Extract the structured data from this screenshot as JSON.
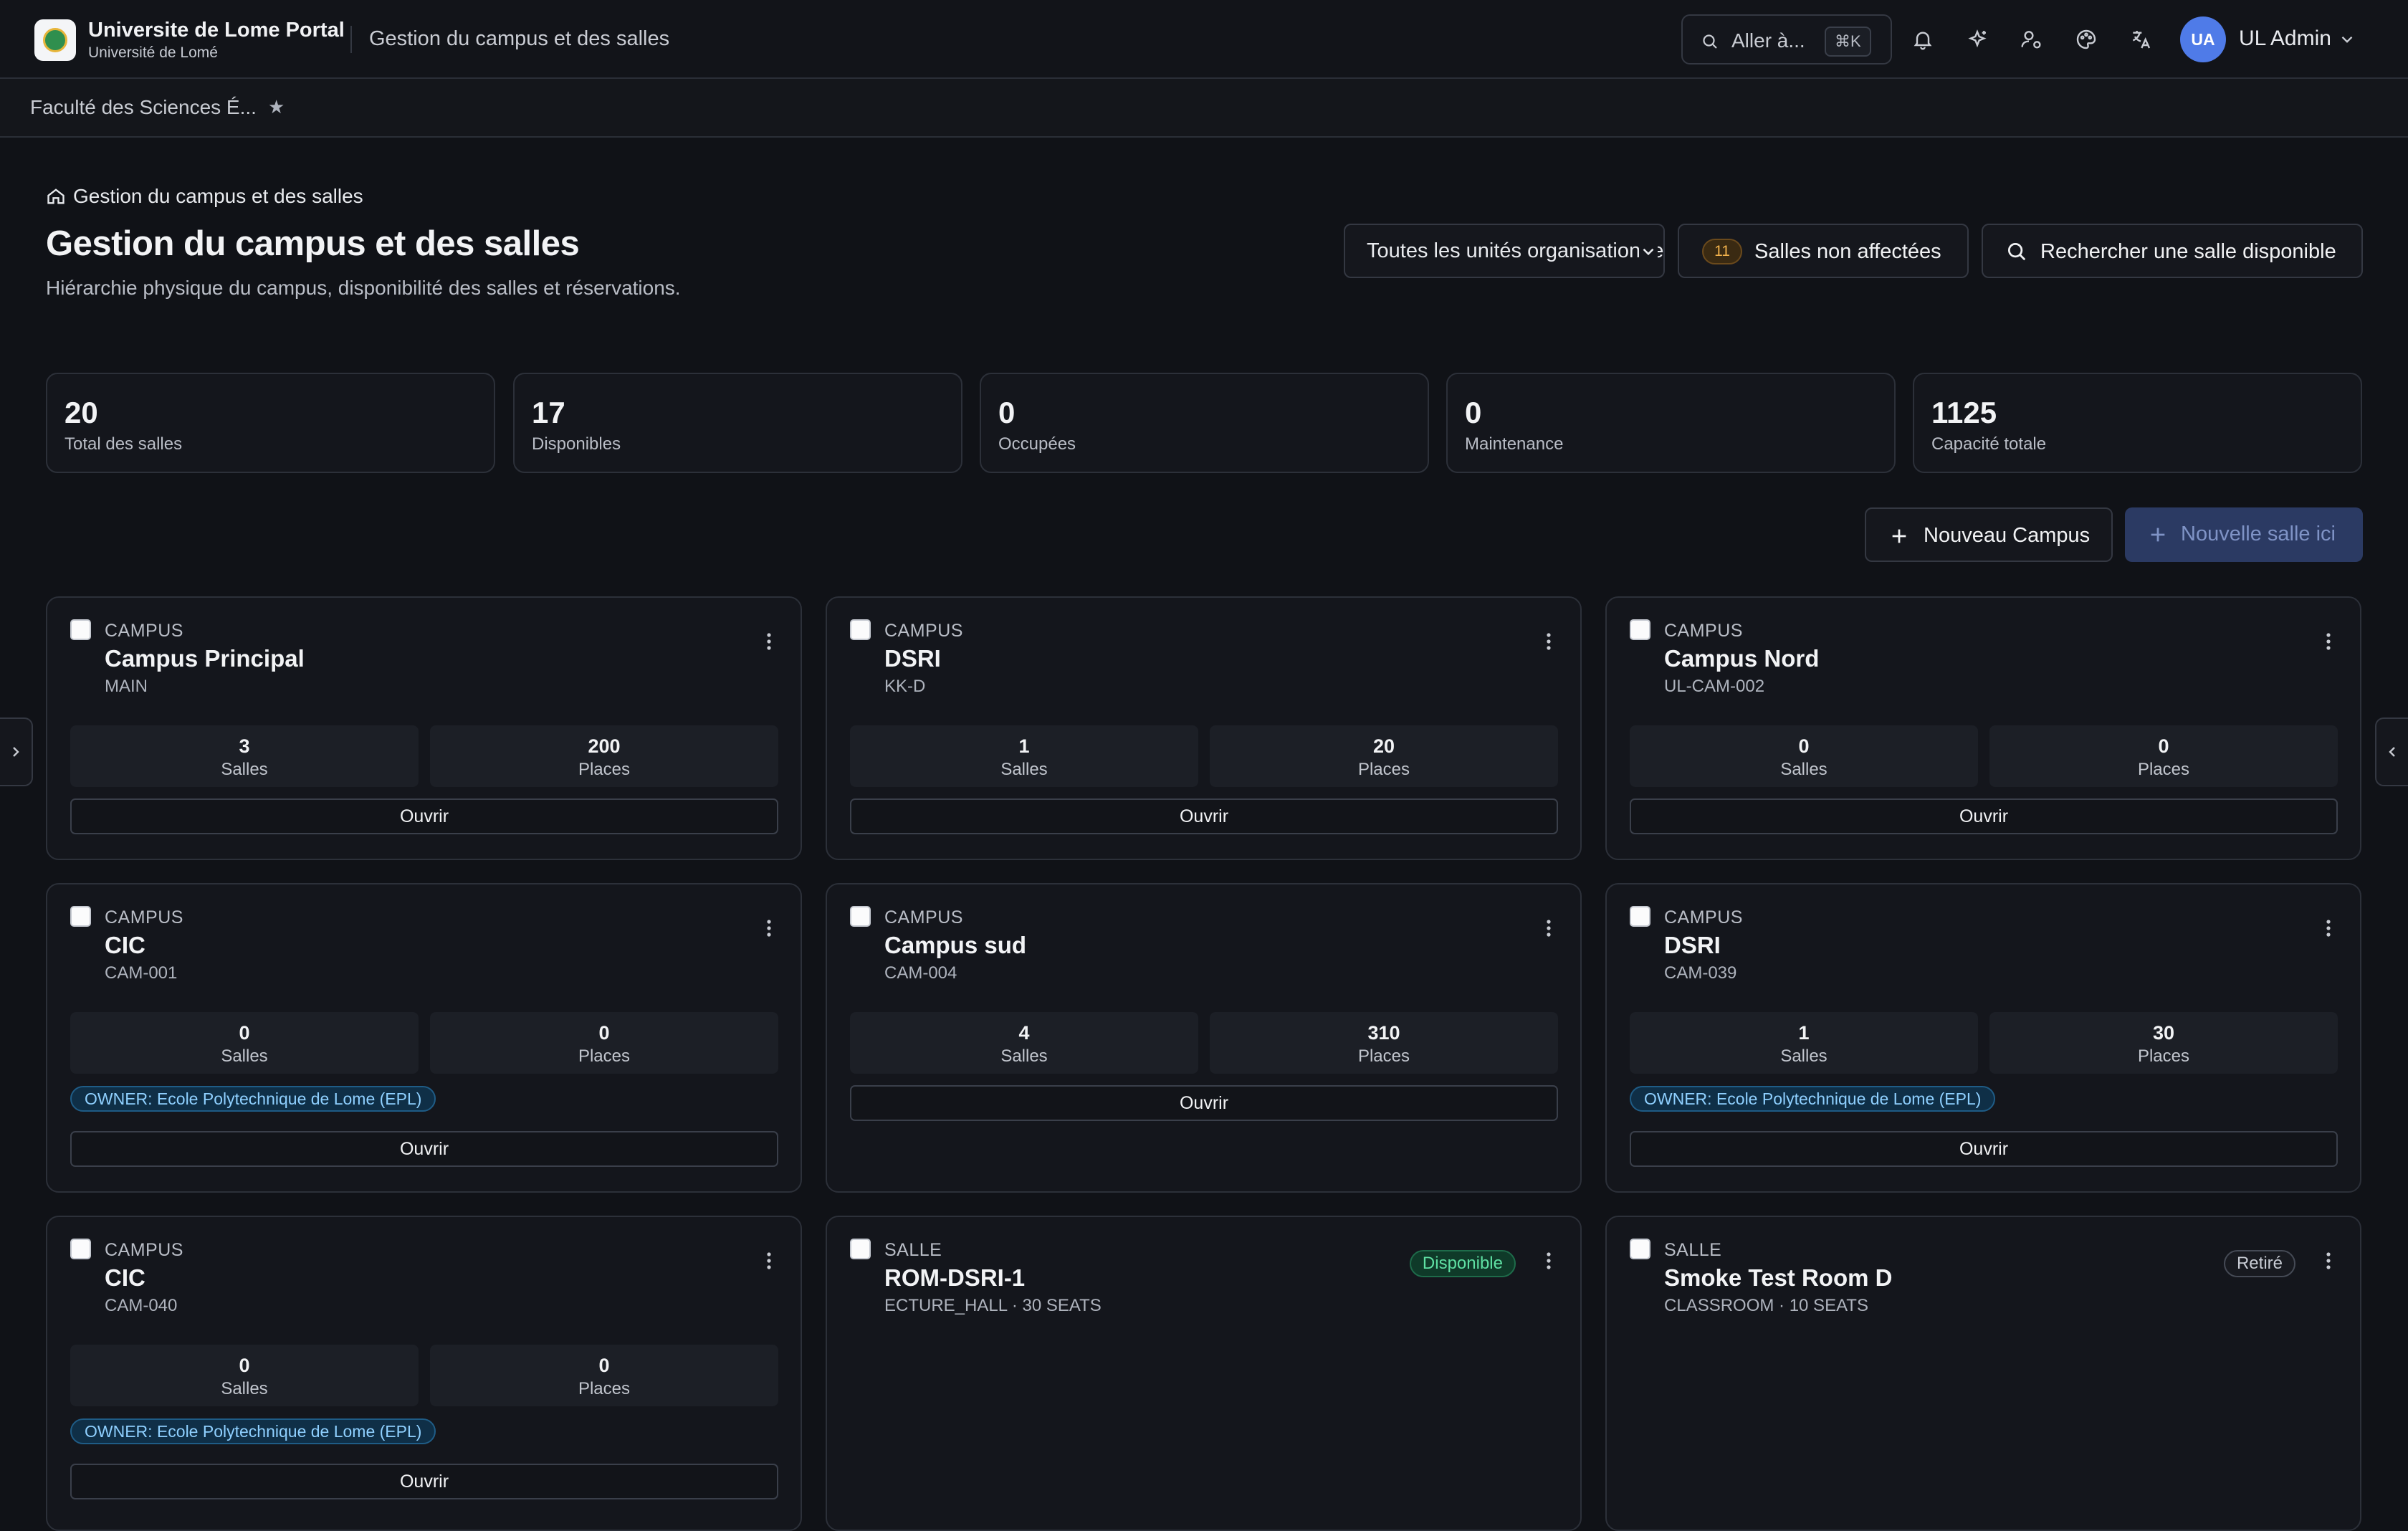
{
  "header": {
    "app_name": "Universite de Lome Portal",
    "app_sub": "Université de Lomé",
    "page_context": "Gestion du campus et des salles",
    "goto_label": "Aller à...",
    "goto_shortcut": "⌘K",
    "user_initials": "UA",
    "user_name": "UL Admin"
  },
  "subbar": {
    "org_tab": "Faculté des Sciences É...",
    "star": "★"
  },
  "page": {
    "breadcrumb": "Gestion du campus et des salles",
    "title": "Gestion du campus et des salles",
    "description": "Hiérarchie physique du campus, disponibilité des salles et réservations.",
    "org_select": "Toutes les unités organisationnelles",
    "unassigned_count": "11",
    "unassigned_label": "Salles non affectées",
    "find_room_label": "Rechercher une salle disponible"
  },
  "stats": [
    {
      "value": "20",
      "label": "Total des salles"
    },
    {
      "value": "17",
      "label": "Disponibles"
    },
    {
      "value": "0",
      "label": "Occupées"
    },
    {
      "value": "0",
      "label": "Maintenance"
    },
    {
      "value": "1125",
      "label": "Capacité totale"
    }
  ],
  "actions": {
    "new_campus": "Nouveau Campus",
    "new_room": "Nouvelle salle ici"
  },
  "cards": [
    {
      "type": "CAMPUS",
      "name": "Campus Principal",
      "code": "MAIN",
      "salles": "3",
      "salles_label": "Salles",
      "places": "200",
      "places_label": "Places",
      "open": "Ouvrir"
    },
    {
      "type": "CAMPUS",
      "name": "DSRI",
      "code": "KK-D",
      "salles": "1",
      "salles_label": "Salles",
      "places": "20",
      "places_label": "Places",
      "open": "Ouvrir"
    },
    {
      "type": "CAMPUS",
      "name": "Campus Nord",
      "code": "UL-CAM-002",
      "salles": "0",
      "salles_label": "Salles",
      "places": "0",
      "places_label": "Places",
      "open": "Ouvrir"
    },
    {
      "type": "CAMPUS",
      "name": "CIC",
      "code": "CAM-001",
      "salles": "0",
      "salles_label": "Salles",
      "places": "0",
      "places_label": "Places",
      "owner": "OWNER: Ecole Polytechnique de Lome (EPL)",
      "open": "Ouvrir"
    },
    {
      "type": "CAMPUS",
      "name": "Campus sud",
      "code": "CAM-004",
      "salles": "4",
      "salles_label": "Salles",
      "places": "310",
      "places_label": "Places",
      "open": "Ouvrir"
    },
    {
      "type": "CAMPUS",
      "name": "DSRI",
      "code": "CAM-039",
      "salles": "1",
      "salles_label": "Salles",
      "places": "30",
      "places_label": "Places",
      "owner": "OWNER: Ecole Polytechnique de Lome (EPL)",
      "open": "Ouvrir"
    },
    {
      "type": "CAMPUS",
      "name": "CIC",
      "code": "CAM-040",
      "salles": "0",
      "salles_label": "Salles",
      "places": "0",
      "places_label": "Places",
      "owner": "OWNER: Ecole Polytechnique de Lome (EPL)",
      "open": "Ouvrir"
    },
    {
      "type": "SALLE",
      "name": "ROM-DSRI-1",
      "code": "ECTURE_HALL · 30 SEATS",
      "status": "Disponible"
    },
    {
      "type": "SALLE",
      "name": "Smoke Test Room D",
      "code": "CLASSROOM · 10 SEATS",
      "status": "Retiré"
    }
  ],
  "colors": {
    "background": "#101217",
    "accent": "#4f7be8",
    "available": "#5fe0a3",
    "owner": "#8fd0ff",
    "badge": "#f2b24c"
  }
}
